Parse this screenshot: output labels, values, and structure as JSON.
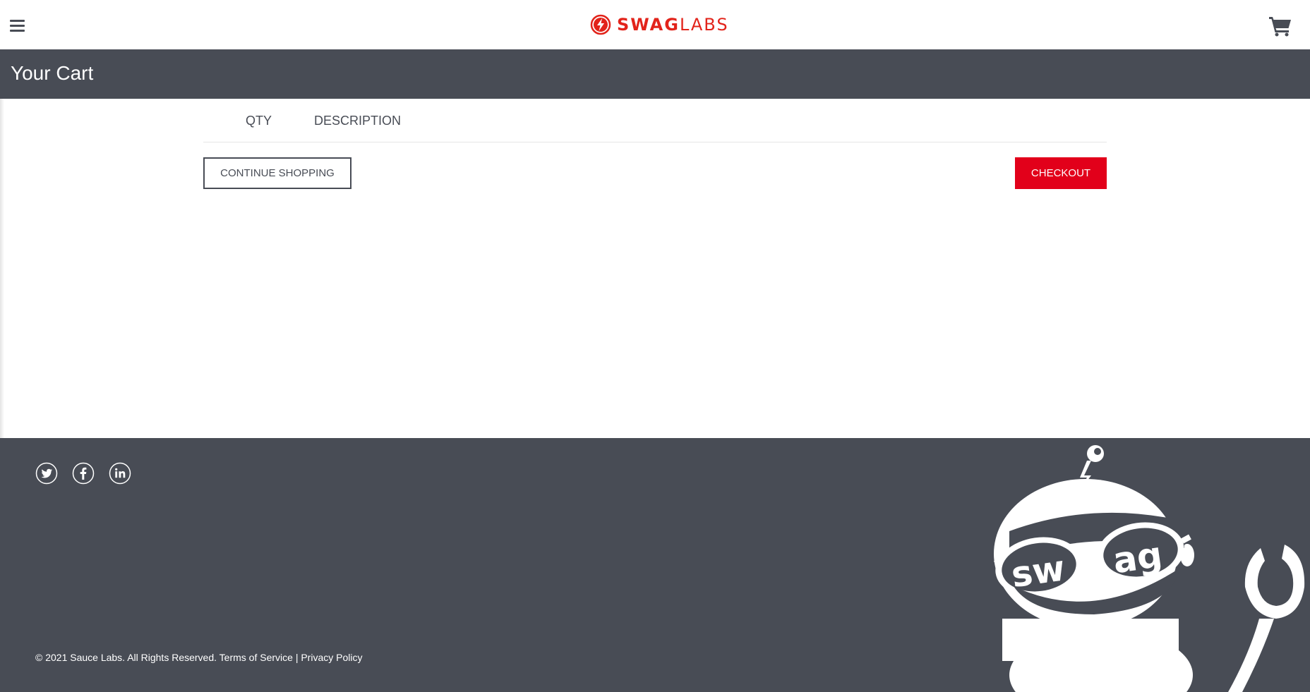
{
  "header": {
    "menu_icon": "hamburger-menu-icon",
    "logo": {
      "bold": "SWAG",
      "light": "LABS",
      "icon": "swag-labs-bolt-icon",
      "color": "#e2231a"
    },
    "cart_icon": "shopping-cart-icon"
  },
  "title_bar": {
    "title": "Your Cart",
    "background": "#484c55"
  },
  "cart": {
    "columns": [
      "QTY",
      "DESCRIPTION"
    ],
    "items": [],
    "continue_label": "CONTINUE SHOPPING",
    "checkout_label": "CHECKOUT",
    "checkout_color": "#e2001a"
  },
  "footer": {
    "social": [
      {
        "name": "Twitter",
        "icon": "twitter-icon"
      },
      {
        "name": "Facebook",
        "icon": "facebook-icon"
      },
      {
        "name": "LinkedIn",
        "icon": "linkedin-icon"
      }
    ],
    "copyright": "© 2021 Sauce Labs. All Rights Reserved.",
    "terms": "Terms of Service",
    "separator": "|",
    "privacy": "Privacy Policy",
    "mascot_text": "swag",
    "background": "#484c55"
  }
}
